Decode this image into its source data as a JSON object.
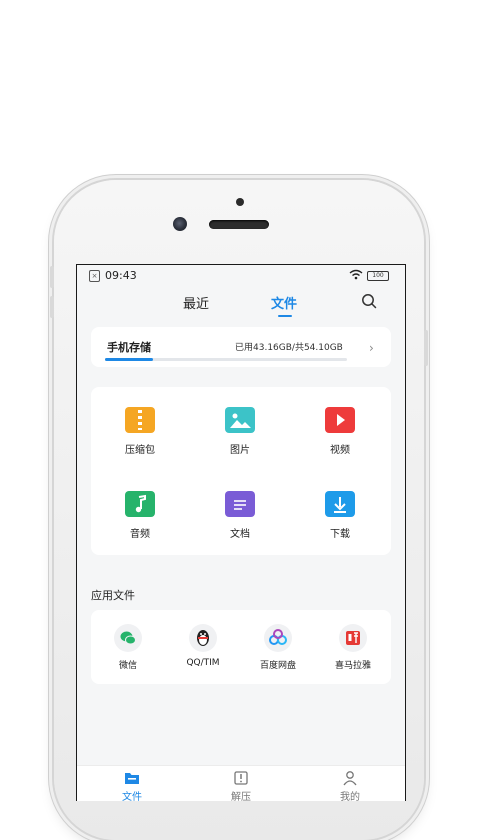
{
  "status_bar": {
    "time": "09:43",
    "battery": "100"
  },
  "top_tabs": [
    {
      "label": "最近",
      "active": false
    },
    {
      "label": "文件",
      "active": true
    }
  ],
  "storage": {
    "title": "手机存储",
    "usage": "已用43.16GB/共54.10GB",
    "fill_fraction": 0.2
  },
  "categories": [
    {
      "label": "压缩包",
      "icon": "zip-icon",
      "color": "#f5a623"
    },
    {
      "label": "图片",
      "icon": "image-icon",
      "color": "#3cc3c8"
    },
    {
      "label": "视频",
      "icon": "video-icon",
      "color": "#ee3b3b"
    },
    {
      "label": "音频",
      "icon": "audio-icon",
      "color": "#26b36b"
    },
    {
      "label": "文档",
      "icon": "document-icon",
      "color": "#7a5cd6"
    },
    {
      "label": "下载",
      "icon": "download-icon",
      "color": "#1e9be9"
    }
  ],
  "app_files_title": "应用文件",
  "app_files": [
    {
      "label": "微信",
      "icon": "wechat-icon"
    },
    {
      "label": "QQ/TIM",
      "icon": "qq-icon"
    },
    {
      "label": "百度网盘",
      "icon": "baidu-netdisk-icon"
    },
    {
      "label": "喜马拉雅",
      "icon": "ximalaya-icon"
    }
  ],
  "bottom_nav": [
    {
      "label": "文件",
      "icon": "folder-icon",
      "active": true
    },
    {
      "label": "解压",
      "icon": "unzip-icon",
      "active": false
    },
    {
      "label": "我的",
      "icon": "profile-icon",
      "active": false
    }
  ],
  "colors": {
    "accent": "#1e88e5",
    "background": "#f5f6f7"
  }
}
